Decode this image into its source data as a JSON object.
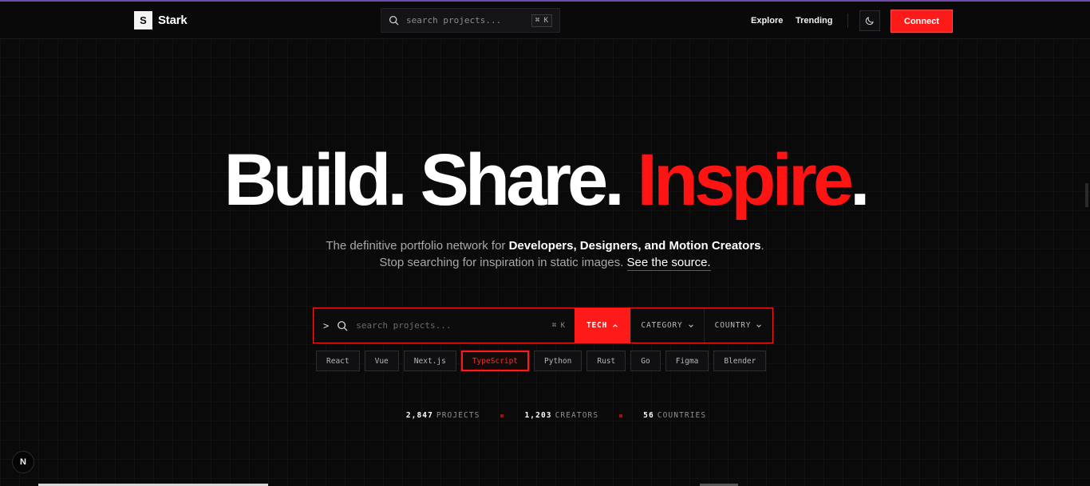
{
  "brand": {
    "mark": "S",
    "name": "Stark"
  },
  "nav": {
    "search_placeholder": "search projects...",
    "search_shortcut": "⌘ K",
    "links": [
      {
        "label": "Explore"
      },
      {
        "label": "Trending"
      }
    ],
    "connect_label": "Connect"
  },
  "hero": {
    "title_part1": "Build. Share. ",
    "title_accent": "Inspire",
    "title_end": ".",
    "subtitle_line1_prefix": "The definitive portfolio network for ",
    "subtitle_line1_bold": "Developers, Designers, and Motion Creators",
    "subtitle_line1_suffix": ".",
    "subtitle_line2_prefix": "Stop searching for inspiration in static images. ",
    "subtitle_line2_link": "See the source."
  },
  "search": {
    "prompt": ">",
    "placeholder": "search projects...",
    "shortcut": "⌘ K",
    "filters": {
      "tech": "TECH",
      "category": "CATEGORY",
      "country": "COUNTRY"
    }
  },
  "tags": [
    {
      "label": "React",
      "active": false
    },
    {
      "label": "Vue",
      "active": false
    },
    {
      "label": "Next.js",
      "active": false
    },
    {
      "label": "TypeScript",
      "active": true
    },
    {
      "label": "Python",
      "active": false
    },
    {
      "label": "Rust",
      "active": false
    },
    {
      "label": "Go",
      "active": false
    },
    {
      "label": "Figma",
      "active": false
    },
    {
      "label": "Blender",
      "active": false
    }
  ],
  "stats": [
    {
      "num": "2,847",
      "label": "PROJECTS"
    },
    {
      "num": "1,203",
      "label": "CREATORS"
    },
    {
      "num": "56",
      "label": "COUNTRIES"
    }
  ],
  "next_badge": "N",
  "colors": {
    "accent": "#ff1a1a",
    "background": "#0a0a0b",
    "topline": "#6f4aa8"
  }
}
